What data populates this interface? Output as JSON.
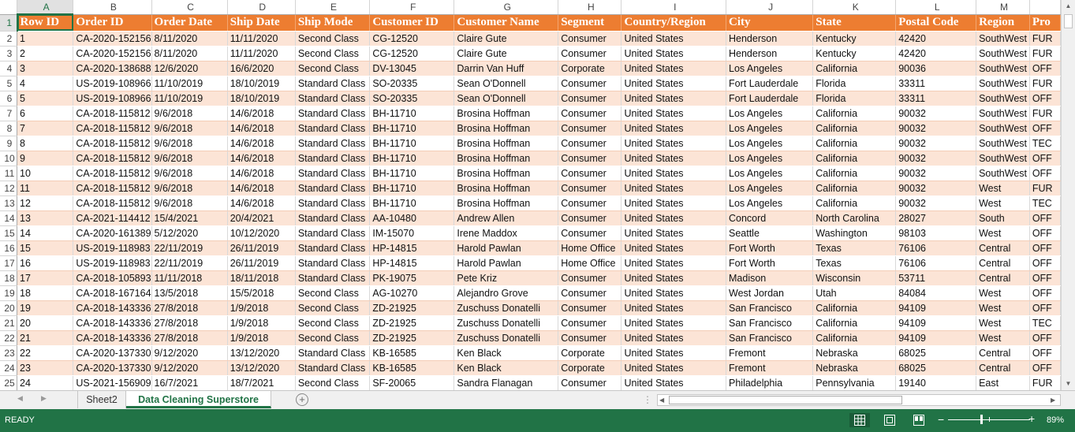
{
  "columns": [
    "A",
    "B",
    "C",
    "D",
    "E",
    "F",
    "G",
    "H",
    "I",
    "J",
    "K",
    "L",
    "M",
    ""
  ],
  "rows": [
    [
      "Row ID",
      "Order ID",
      "Order Date",
      "Ship Date",
      "Ship Mode",
      "Customer ID",
      "Customer Name",
      "Segment",
      "Country/Region",
      "City",
      "State",
      "Postal Code",
      "Region",
      "Pro"
    ],
    [
      "1",
      "CA-2020-152156",
      "8/11/2020",
      "11/11/2020",
      "Second Class",
      "CG-12520",
      "Claire Gute",
      "Consumer",
      "United States",
      "Henderson",
      "Kentucky",
      "42420",
      "SouthWest",
      "FUR"
    ],
    [
      "2",
      "CA-2020-152156",
      "8/11/2020",
      "11/11/2020",
      "Second Class",
      "CG-12520",
      "Claire Gute",
      "Consumer",
      "United States",
      "Henderson",
      "Kentucky",
      "42420",
      "SouthWest",
      "FUR"
    ],
    [
      "3",
      "CA-2020-138688",
      "12/6/2020",
      "16/6/2020",
      "Second Class",
      "DV-13045",
      "Darrin Van Huff",
      "Corporate",
      "United States",
      "Los Angeles",
      "California",
      "90036",
      "SouthWest",
      "OFF"
    ],
    [
      "4",
      "US-2019-108966",
      "11/10/2019",
      "18/10/2019",
      "Standard Class",
      "SO-20335",
      "Sean O'Donnell",
      "Consumer",
      "United States",
      "Fort Lauderdale",
      "Florida",
      "33311",
      "SouthWest",
      "FUR"
    ],
    [
      "5",
      "US-2019-108966",
      "11/10/2019",
      "18/10/2019",
      "Standard Class",
      "SO-20335",
      "Sean O'Donnell",
      "Consumer",
      "United States",
      "Fort Lauderdale",
      "Florida",
      "33311",
      "SouthWest",
      "OFF"
    ],
    [
      "6",
      "CA-2018-115812",
      "9/6/2018",
      "14/6/2018",
      "Standard Class",
      "BH-11710",
      "Brosina Hoffman",
      "Consumer",
      "United States",
      "Los Angeles",
      "California",
      "90032",
      "SouthWest",
      "FUR"
    ],
    [
      "7",
      "CA-2018-115812",
      "9/6/2018",
      "14/6/2018",
      "Standard Class",
      "BH-11710",
      "Brosina Hoffman",
      "Consumer",
      "United States",
      "Los Angeles",
      "California",
      "90032",
      "SouthWest",
      "OFF"
    ],
    [
      "8",
      "CA-2018-115812",
      "9/6/2018",
      "14/6/2018",
      "Standard Class",
      "BH-11710",
      "Brosina Hoffman",
      "Consumer",
      "United States",
      "Los Angeles",
      "California",
      "90032",
      "SouthWest",
      "TEC"
    ],
    [
      "9",
      "CA-2018-115812",
      "9/6/2018",
      "14/6/2018",
      "Standard Class",
      "BH-11710",
      "Brosina Hoffman",
      "Consumer",
      "United States",
      "Los Angeles",
      "California",
      "90032",
      "SouthWest",
      "OFF"
    ],
    [
      "10",
      "CA-2018-115812",
      "9/6/2018",
      "14/6/2018",
      "Standard Class",
      "BH-11710",
      "Brosina Hoffman",
      "Consumer",
      "United States",
      "Los Angeles",
      "California",
      "90032",
      "SouthWest",
      "OFF"
    ],
    [
      "11",
      "CA-2018-115812",
      "9/6/2018",
      "14/6/2018",
      "Standard Class",
      "BH-11710",
      "Brosina Hoffman",
      "Consumer",
      "United States",
      "Los Angeles",
      "California",
      "90032",
      "West",
      "FUR"
    ],
    [
      "12",
      "CA-2018-115812",
      "9/6/2018",
      "14/6/2018",
      "Standard Class",
      "BH-11710",
      "Brosina Hoffman",
      "Consumer",
      "United States",
      "Los Angeles",
      "California",
      "90032",
      "West",
      "TEC"
    ],
    [
      "13",
      "CA-2021-114412",
      "15/4/2021",
      "20/4/2021",
      "Standard Class",
      "AA-10480",
      "Andrew Allen",
      "Consumer",
      "United States",
      "Concord",
      "North Carolina",
      "28027",
      "South",
      "OFF"
    ],
    [
      "14",
      "CA-2020-161389",
      "5/12/2020",
      "10/12/2020",
      "Standard Class",
      "IM-15070",
      "Irene Maddox",
      "Consumer",
      "United States",
      "Seattle",
      "Washington",
      "98103",
      "West",
      "OFF"
    ],
    [
      "15",
      "US-2019-118983",
      "22/11/2019",
      "26/11/2019",
      "Standard Class",
      "HP-14815",
      "Harold Pawlan",
      "Home Office",
      "United States",
      "Fort Worth",
      "Texas",
      "76106",
      "Central",
      "OFF"
    ],
    [
      "16",
      "US-2019-118983",
      "22/11/2019",
      "26/11/2019",
      "Standard Class",
      "HP-14815",
      "Harold Pawlan",
      "Home Office",
      "United States",
      "Fort Worth",
      "Texas",
      "76106",
      "Central",
      "OFF"
    ],
    [
      "17",
      "CA-2018-105893",
      "11/11/2018",
      "18/11/2018",
      "Standard Class",
      "PK-19075",
      "Pete Kriz",
      "Consumer",
      "United States",
      "Madison",
      "Wisconsin",
      "53711",
      "Central",
      "OFF"
    ],
    [
      "18",
      "CA-2018-167164",
      "13/5/2018",
      "15/5/2018",
      "Second Class",
      "AG-10270",
      "Alejandro Grove",
      "Consumer",
      "United States",
      "West Jordan",
      "Utah",
      "84084",
      "West",
      "OFF"
    ],
    [
      "19",
      "CA-2018-143336",
      "27/8/2018",
      "1/9/2018",
      "Second Class",
      "ZD-21925",
      "Zuschuss Donatelli",
      "Consumer",
      "United States",
      "San Francisco",
      "California",
      "94109",
      "West",
      "OFF"
    ],
    [
      "20",
      "CA-2018-143336",
      "27/8/2018",
      "1/9/2018",
      "Second Class",
      "ZD-21925",
      "Zuschuss Donatelli",
      "Consumer",
      "United States",
      "San Francisco",
      "California",
      "94109",
      "West",
      "TEC"
    ],
    [
      "21",
      "CA-2018-143336",
      "27/8/2018",
      "1/9/2018",
      "Second Class",
      "ZD-21925",
      "Zuschuss Donatelli",
      "Consumer",
      "United States",
      "San Francisco",
      "California",
      "94109",
      "West",
      "OFF"
    ],
    [
      "22",
      "CA-2020-137330",
      "9/12/2020",
      "13/12/2020",
      "Standard Class",
      "KB-16585",
      "Ken Black",
      "Corporate",
      "United States",
      "Fremont",
      "Nebraska",
      "68025",
      "Central",
      "OFF"
    ],
    [
      "23",
      "CA-2020-137330",
      "9/12/2020",
      "13/12/2020",
      "Standard Class",
      "KB-16585",
      "Ken Black",
      "Corporate",
      "United States",
      "Fremont",
      "Nebraska",
      "68025",
      "Central",
      "OFF"
    ],
    [
      "24",
      "US-2021-156909",
      "16/7/2021",
      "18/7/2021",
      "Second Class",
      "SF-20065",
      "Sandra Flanagan",
      "Consumer",
      "United States",
      "Philadelphia",
      "Pennsylvania",
      "19140",
      "East",
      "FUR"
    ]
  ],
  "tabs": {
    "sheet2": "Sheet2",
    "active": "Data Cleaning Superstore",
    "add": "+"
  },
  "status": {
    "ready": "READY",
    "zoom": "89%",
    "zoom_minus": "−",
    "zoom_plus": "+"
  },
  "colors": {
    "header_fill": "#ed7d31",
    "band_fill": "#fce4d6",
    "accent": "#217346"
  }
}
